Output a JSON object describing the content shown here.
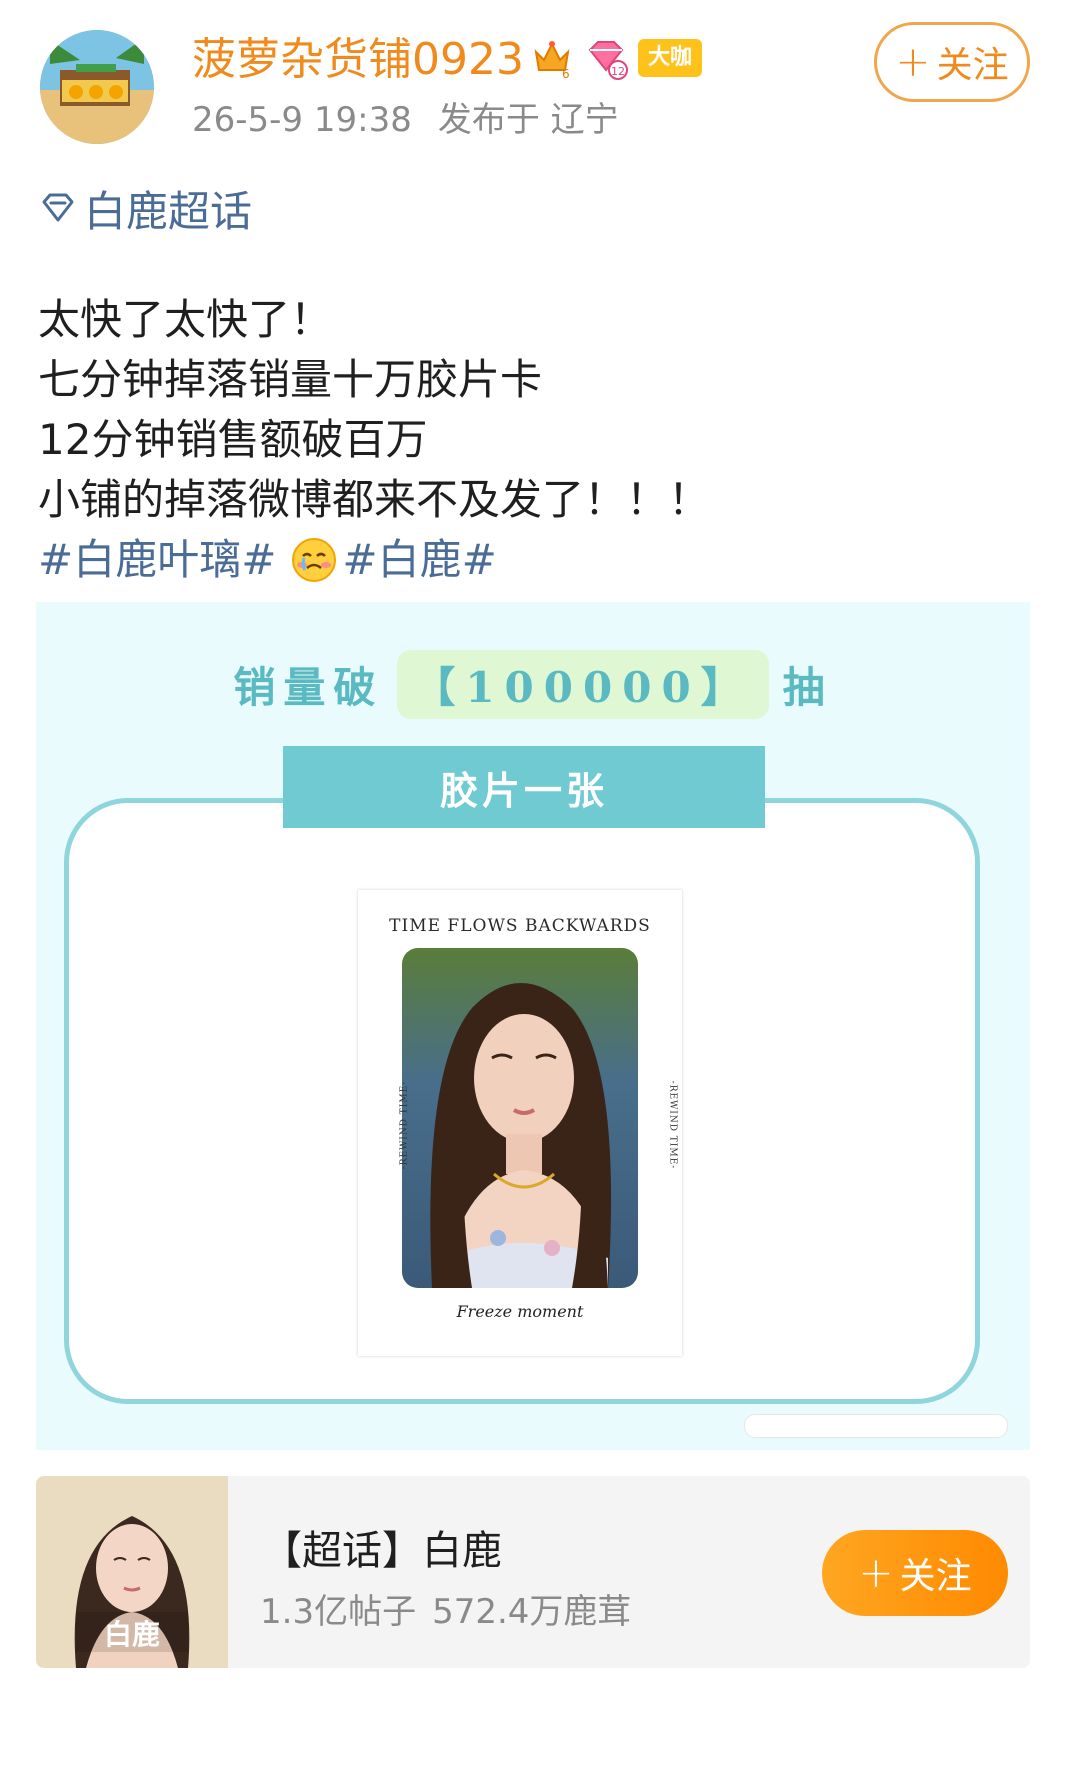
{
  "post": {
    "author": {
      "name": "菠萝杂货铺0923",
      "vip_label": "大咖",
      "crown_level": "6",
      "diamond_level": "12"
    },
    "timestamp": "26-5-9 19:38",
    "location": "发布于 辽宁",
    "follow_label": "关注",
    "supertopic_tag": "白鹿超话",
    "lines": [
      "太快了太快了！",
      "七分钟掉落销量十万胶片卡",
      "12分钟销售额破百万",
      "小铺的掉落微博都来不及发了！！！"
    ],
    "hashtags": [
      "#白鹿叶璃#",
      "#白鹿#"
    ],
    "emoji": "cry-smile-emoji"
  },
  "image": {
    "headline_prefix": "销量破",
    "headline_number": "【100000】",
    "headline_suffix": "抽",
    "ribbon": "胶片一张",
    "card": {
      "title": "TIME FLOWS BACKWARDS",
      "side_text": "-REWIND TIME-",
      "footer": "Freeze moment"
    }
  },
  "topic_card": {
    "name": "【超话】白鹿",
    "posts": "1.3亿帖子",
    "fans": "572.4万鹿茸",
    "follow_label": "关注",
    "cover_text": "白鹿"
  },
  "colors": {
    "username": "#f08a1c",
    "link": "#4b6c96",
    "accent_teal": "#6fcbd1",
    "follow_orange": "#ff9a10"
  }
}
